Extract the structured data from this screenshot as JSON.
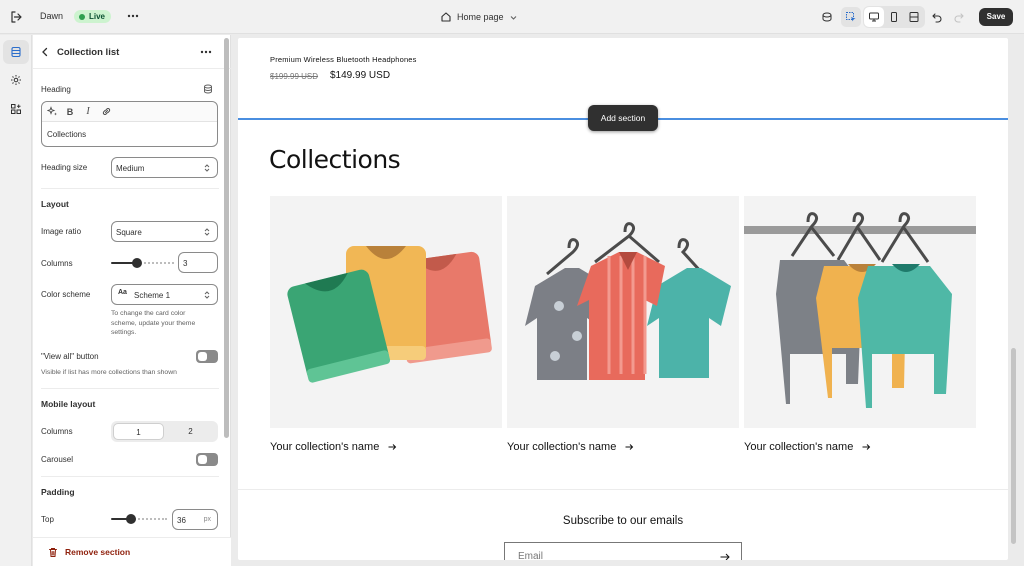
{
  "topbar": {
    "theme_name": "Dawn",
    "live_badge": "Live",
    "page_selector": "Home page",
    "save_label": "Save"
  },
  "panel": {
    "title": "Collection list",
    "heading_label": "Heading",
    "heading_value": "Collections",
    "heading_size_label": "Heading size",
    "heading_size_value": "Medium",
    "layout_title": "Layout",
    "image_ratio_label": "Image ratio",
    "image_ratio_value": "Square",
    "columns_label": "Columns",
    "columns_value": "3",
    "color_scheme_label": "Color scheme",
    "color_scheme_value": "Scheme 1",
    "color_scheme_help": [
      "To change the card color",
      "scheme, update your theme",
      "settings."
    ],
    "view_all_label": "\"View all\" button",
    "view_all_help": "Visible if list has more collections than shown",
    "mobile_layout_title": "Mobile layout",
    "mobile_columns_label": "Columns",
    "mobile_columns_options": [
      "1",
      "2"
    ],
    "carousel_label": "Carousel",
    "padding_title": "Padding",
    "top_label": "Top",
    "top_value": "36",
    "top_unit": "px",
    "remove_label": "Remove section"
  },
  "preview": {
    "product_name": "Premium Wireless Bluetooth Headphones",
    "price_old": "$199.99 USD",
    "price_new": "$149.99 USD",
    "add_section_label": "Add section",
    "collections_heading": "Collections",
    "cards": [
      {
        "name": "Your collection's name"
      },
      {
        "name": "Your collection's name"
      },
      {
        "name": "Your collection's name"
      }
    ],
    "subscribe_title": "Subscribe to our emails",
    "email_placeholder": "Email"
  },
  "colors": {
    "accent_line": "#4a8ee0",
    "live_green": "#cdf3cf",
    "remove_red": "#8e1f0b"
  }
}
